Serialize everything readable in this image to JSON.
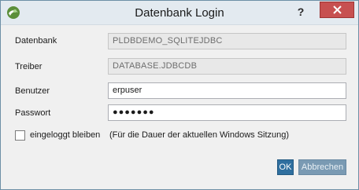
{
  "window": {
    "title": "Datenbank Login",
    "help_label": "?",
    "close_icon": "close-icon",
    "app_icon": "database-app-icon"
  },
  "form": {
    "datenbank": {
      "label": "Datenbank",
      "value": "PLDBDEMO_SQLITEJDBC"
    },
    "treiber": {
      "label": "Treiber",
      "value": "DATABASE.JDBCDB"
    },
    "benutzer": {
      "label": "Benutzer",
      "value": "erpuser"
    },
    "passwort": {
      "label": "Passwort",
      "value": "●●●●●●●"
    }
  },
  "remember": {
    "label": "eingeloggt bleiben",
    "note": "(Für die Dauer der aktuellen Windows Sitzung)",
    "checked": false
  },
  "buttons": {
    "ok_label": "OK",
    "cancel_label": "Abbrechen"
  },
  "colors": {
    "close_button": "#c75050",
    "ok_button": "#2f6f9f",
    "cancel_button": "#7a9ab3",
    "titlebar": "#e3eaf0"
  }
}
